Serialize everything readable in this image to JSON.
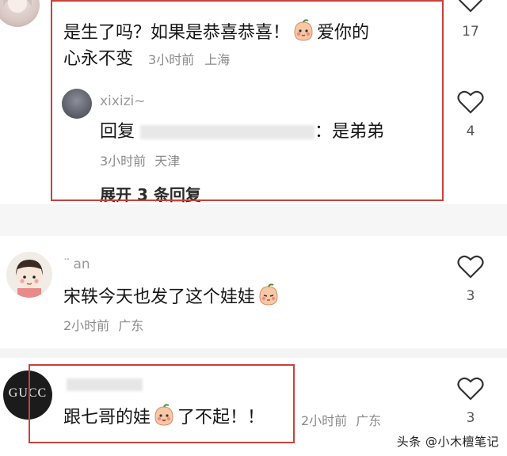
{
  "comments": [
    {
      "username": "",
      "text_before_emoji": "是生了吗？如果是恭喜恭喜！",
      "text_after_emoji_line1": "爱你的",
      "text_line2": "心永不变",
      "emoji_icon": "peach-face-emoji-icon",
      "time": "3小时前",
      "location": "上海",
      "likes": "17"
    },
    {
      "username": "xixizi~",
      "reply_prefix": "回复",
      "reply_to": "",
      "reply_text": "：是弟弟",
      "time": "3小时前",
      "location": "天津",
      "likes": "4",
      "expand_label": "展开 3 条回复"
    },
    {
      "username": "an",
      "text": "宋轶今天也发了这个娃娃",
      "emoji_icon": "peach-face-emoji-icon",
      "time": "2小时前",
      "location": "广东",
      "likes": "3"
    },
    {
      "username": "",
      "text_before_emoji": "跟七哥的娃",
      "text_after_emoji": "了不起！！",
      "emoji_icon": "peach-face-emoji-icon",
      "time": "2小时前",
      "location": "广东",
      "likes": "3",
      "avatar_text": "GUCC"
    }
  ],
  "watermark": "头条 @小木檀笔记",
  "colors": {
    "highlight_box": "#c9413a",
    "meta_text": "#8a8a8a",
    "link_text": "#2a2a2a"
  },
  "icons": [
    "heart-outline-icon",
    "peach-face-emoji-icon"
  ]
}
